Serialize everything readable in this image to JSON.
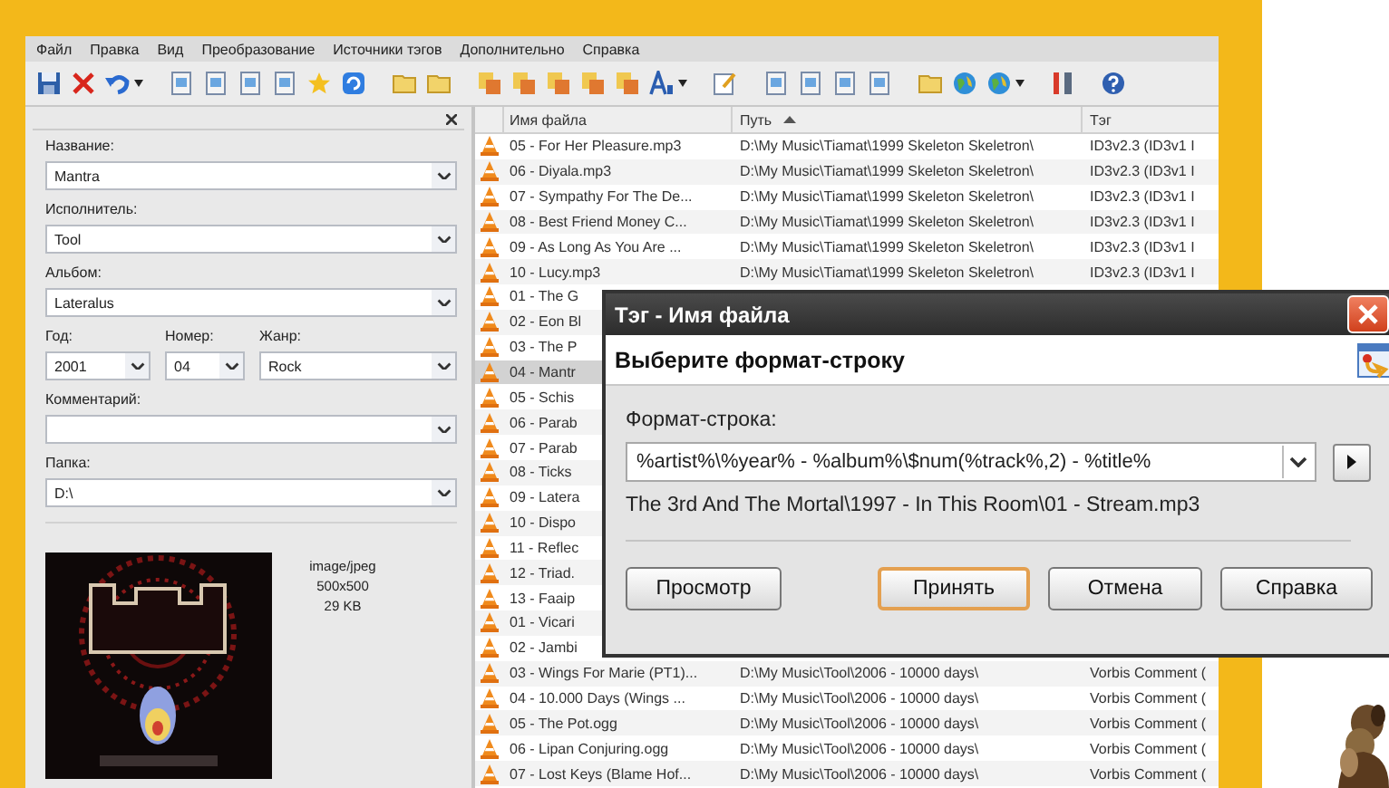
{
  "menu": [
    "Файл",
    "Правка",
    "Вид",
    "Преобразование",
    "Источники тэгов",
    "Дополнительно",
    "Справка"
  ],
  "tag_panel": {
    "fields_top": [
      {
        "label": "Название:",
        "value": "Mantra"
      },
      {
        "label": "Исполнитель:",
        "value": "Tool"
      },
      {
        "label": "Альбом:",
        "value": "Lateralus"
      }
    ],
    "fields_row": [
      {
        "label": "Год:",
        "value": "2001"
      },
      {
        "label": "Номер:",
        "value": "04"
      },
      {
        "label": "Жанр:",
        "value": "Rock"
      }
    ],
    "fields_bottom": [
      {
        "label": "Комментарий:"
      },
      {
        "label": "Папка:",
        "value": "D:\\"
      }
    ],
    "cover_info": [
      "image/jpeg",
      "500x500",
      "29 KB"
    ]
  },
  "file_list": {
    "columns": [
      {
        "label": "Имя файла",
        "sorted": false
      },
      {
        "label": "Путь",
        "sorted": true
      },
      {
        "label": "Тэг",
        "sorted": false
      }
    ],
    "rows": [
      {
        "filename": "05 - For Her Pleasure.mp3",
        "path": "D:\\My Music\\Tiamat\\1999 Skeleton Skeletron\\",
        "tag": "ID3v2.3 (ID3v1 I",
        "selected": false
      },
      {
        "filename": "06 - Diyala.mp3",
        "path": "D:\\My Music\\Tiamat\\1999 Skeleton Skeletron\\",
        "tag": "ID3v2.3 (ID3v1 I",
        "selected": false
      },
      {
        "filename": "07 - Sympathy For The De...",
        "path": "D:\\My Music\\Tiamat\\1999 Skeleton Skeletron\\",
        "tag": "ID3v2.3 (ID3v1 I",
        "selected": false
      },
      {
        "filename": "08 - Best Friend Money C...",
        "path": "D:\\My Music\\Tiamat\\1999 Skeleton Skeletron\\",
        "tag": "ID3v2.3 (ID3v1 I",
        "selected": false
      },
      {
        "filename": "09 - As Long As You Are ...",
        "path": "D:\\My Music\\Tiamat\\1999 Skeleton Skeletron\\",
        "tag": "ID3v2.3 (ID3v1 I",
        "selected": false
      },
      {
        "filename": "10 - Lucy.mp3",
        "path": "D:\\My Music\\Tiamat\\1999 Skeleton Skeletron\\",
        "tag": "ID3v2.3 (ID3v1 I",
        "selected": false
      },
      {
        "filename": "01 - The G",
        "selected": false
      },
      {
        "filename": "02 - Eon Bl",
        "selected": false
      },
      {
        "filename": "03 - The P",
        "selected": false
      },
      {
        "filename": "04 - Mantr",
        "selected": true
      },
      {
        "filename": "05 - Schis",
        "selected": false
      },
      {
        "filename": "06 - Parab",
        "selected": false
      },
      {
        "filename": "07 - Parab",
        "selected": false
      },
      {
        "filename": "08 - Ticks",
        "selected": false
      },
      {
        "filename": "09 - Latera",
        "selected": false
      },
      {
        "filename": "10 - Dispo",
        "selected": false
      },
      {
        "filename": "11 - Reflec",
        "selected": false
      },
      {
        "filename": "12 - Triad.",
        "selected": false
      },
      {
        "filename": "13 - Faaip",
        "selected": false
      },
      {
        "filename": "01 - Vicari",
        "selected": false
      },
      {
        "filename": "02 - Jambi",
        "selected": false
      },
      {
        "filename": "03 - Wings For Marie (PT1)...",
        "path": "D:\\My Music\\Tool\\2006 - 10000 days\\",
        "tag": "Vorbis Comment (",
        "selected": false
      },
      {
        "filename": "04 - 10.000 Days (Wings ...",
        "path": "D:\\My Music\\Tool\\2006 - 10000 days\\",
        "tag": "Vorbis Comment (",
        "selected": false
      },
      {
        "filename": "05 - The Pot.ogg",
        "path": "D:\\My Music\\Tool\\2006 - 10000 days\\",
        "tag": "Vorbis Comment (",
        "selected": false
      },
      {
        "filename": "06 - Lipan Conjuring.ogg",
        "path": "D:\\My Music\\Tool\\2006 - 10000 days\\",
        "tag": "Vorbis Comment (",
        "selected": false
      },
      {
        "filename": "07 - Lost Keys (Blame Hof...",
        "path": "D:\\My Music\\Tool\\2006 - 10000 days\\",
        "tag": "Vorbis Comment (",
        "selected": false
      }
    ]
  },
  "dialog": {
    "title": "Тэг - Имя файла",
    "heading": "Выберите формат-строку",
    "field_label": "Формат-строка:",
    "format_value": "%artist%\\%year% - %album%\\$num(%track%,2) - %title%",
    "preview": "The 3rd And The Mortal\\1997 - In This Room\\01 - Stream.mp3",
    "buttons": [
      {
        "label": "Просмотр",
        "default": false
      },
      {
        "label": "Принять",
        "default": true
      },
      {
        "label": "Отмена",
        "default": false
      },
      {
        "label": "Справка",
        "default": false
      }
    ]
  }
}
